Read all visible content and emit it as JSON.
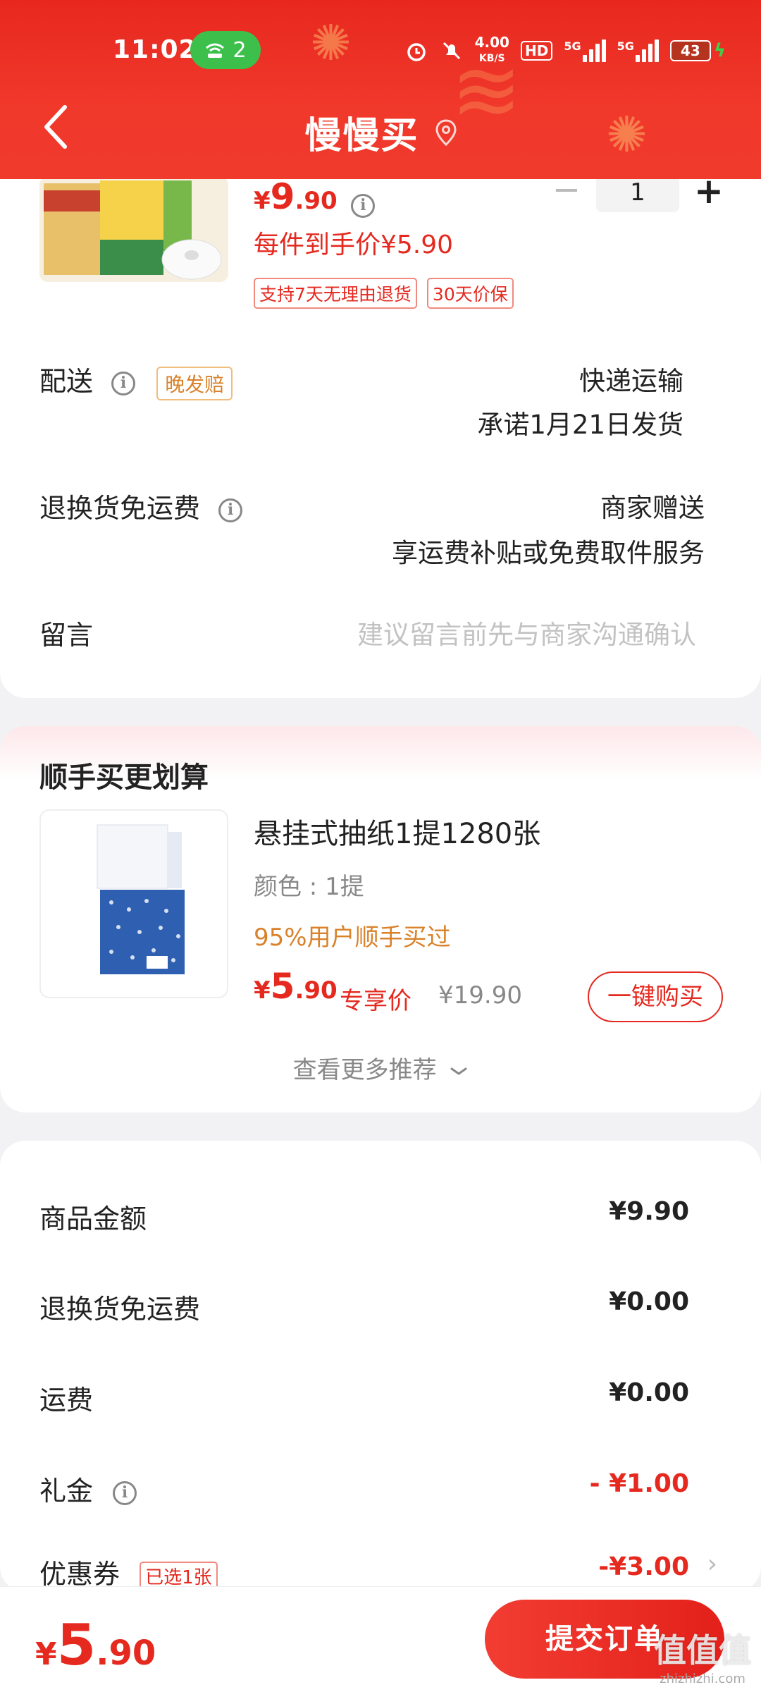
{
  "status_bar": {
    "time": "11:02",
    "hotspot_count": "2",
    "net_speed_top": "4.00",
    "net_speed_bottom": "KB/S",
    "hd_label": "HD",
    "signal1_label": "5G",
    "signal2_label": "5G",
    "battery_level": "43"
  },
  "header": {
    "title": "慢慢买"
  },
  "product": {
    "price_symbol": "¥",
    "price_int": "9",
    "price_dec": ".90",
    "quantity": "1",
    "unit_price_label": "每件到手价¥5.90",
    "tags": [
      "支持7天无理由退货",
      "30天价保"
    ]
  },
  "delivery": {
    "label": "配送",
    "badge": "晚发赔",
    "method": "快递运输",
    "promise": "承诺1月21日发货"
  },
  "return_shipping": {
    "label": "退换货免运费",
    "value_line1": "商家赠送",
    "value_line2": "享运费补贴或免费取件服务"
  },
  "message": {
    "label": "留言",
    "placeholder": "建议留言前先与商家沟通确认"
  },
  "recommend": {
    "title": "顺手买更划算",
    "item_name": "悬挂式抽纸1提1280张",
    "item_spec": "颜色 : 1提",
    "item_social": "95%用户顺手买过",
    "price_symbol": "¥",
    "price_int": "5",
    "price_dec": ".90",
    "exclusive_label": "专享价",
    "original_price": "¥19.90",
    "buy_button": "一键购买",
    "more_label": "查看更多推荐"
  },
  "summary": {
    "rows": [
      {
        "label": "商品金额",
        "value": "¥9.90"
      },
      {
        "label": "退换货免运费",
        "value": "¥0.00"
      },
      {
        "label": "运费",
        "value": "¥0.00"
      },
      {
        "label": "礼金",
        "value": "- ¥1.00"
      },
      {
        "label": "优惠券",
        "value": "-¥3.00",
        "tag": "已选1张"
      }
    ]
  },
  "bottom": {
    "price_symbol": "¥",
    "total_int": "5",
    "total_dec": ".90",
    "submit_label": "提交订单"
  },
  "watermark": {
    "text_big": "值值值",
    "text_small": "zhizhizhi.com"
  },
  "colors": {
    "brand_red": "#e5291f",
    "header_red": "#ef3a2c",
    "hotspot_green": "#3cc04b",
    "accent_orange": "#d9822b"
  }
}
